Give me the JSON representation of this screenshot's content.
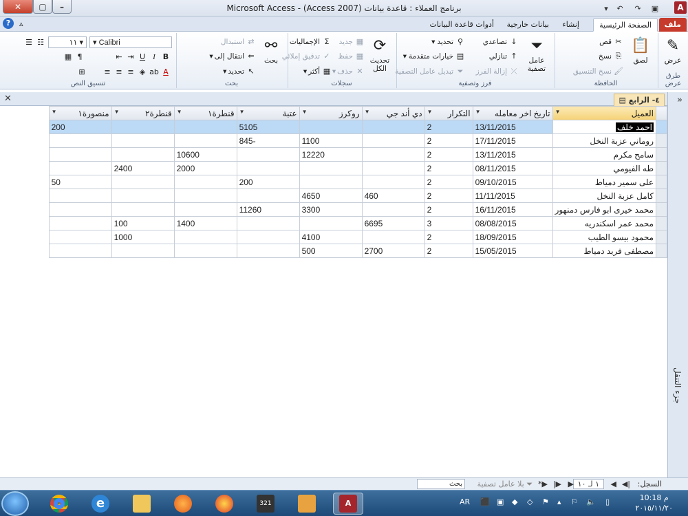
{
  "window": {
    "title": "برنامج العملاء : قاعدة بيانات (Access 2007) - Microsoft Access",
    "app_logo": "A"
  },
  "tabs": [
    {
      "label": "ملف"
    },
    {
      "label": "الصفحة الرئيسية"
    },
    {
      "label": "إنشاء"
    },
    {
      "label": "بيانات خارجية"
    },
    {
      "label": "أدوات قاعدة البيانات"
    }
  ],
  "ribbon": {
    "views": {
      "label": "طرق عرض",
      "view_btn": "عرض"
    },
    "clipboard": {
      "label": "الحافظة",
      "paste": "لصق",
      "cut": "قص",
      "copy": "نسخ",
      "format_painter": "نسخ التنسيق"
    },
    "sort_filter": {
      "label": "فرز وتصفية",
      "filter": "عامل تصفية",
      "ascending": "تصاعدي",
      "descending": "تنازلي",
      "remove_sort": "إزالة الفرز",
      "selection": "تحديد",
      "advanced": "خيارات متقدمة",
      "toggle_filter": "تبديل عامل التصفية"
    },
    "records": {
      "label": "سجلات",
      "refresh": "تحديث الكل",
      "new": "جديد",
      "save": "حفظ",
      "delete": "حذف",
      "totals": "الإجماليات",
      "spelling": "تدقيق إملائي",
      "more": "أكثر"
    },
    "find": {
      "label": "بحث",
      "find": "بحث",
      "replace": "استبدال",
      "goto": "انتقال إلى",
      "select": "تحديد"
    },
    "text_formatting": {
      "label": "تنسيق النص",
      "font": "Calibri",
      "size": "١١"
    }
  },
  "document": {
    "tab_title": "٤- الرابع",
    "nav_pane_label": "جزء التنقل"
  },
  "table": {
    "columns": [
      "العميل",
      "تاريخ اخر معامله",
      "التكرار",
      "دي أند جي",
      "روكرز",
      "عتبة",
      "قنطرة١",
      "قنطرة٢",
      "منصورة١"
    ],
    "rows": [
      [
        "احمد خلف",
        "13/11/2015",
        "2",
        "",
        "",
        "5105",
        "",
        "",
        "200"
      ],
      [
        "روماني عزبة النخل",
        "17/11/2015",
        "2",
        "",
        "1100",
        "-845",
        "",
        "",
        ""
      ],
      [
        "سامح مكرم",
        "13/11/2015",
        "2",
        "",
        "12220",
        "",
        "10600",
        "",
        ""
      ],
      [
        "طه الفيومي",
        "08/11/2015",
        "2",
        "",
        "",
        "",
        "2000",
        "2400",
        ""
      ],
      [
        "على سمير دمياط",
        "09/10/2015",
        "2",
        "",
        "",
        "200",
        "",
        "",
        "50"
      ],
      [
        "كامل عزبة النخل",
        "11/11/2015",
        "2",
        "460",
        "4650",
        "",
        "",
        "",
        ""
      ],
      [
        "محمد خيرى ابو فارس دمنهور",
        "16/11/2015",
        "2",
        "",
        "3300",
        "11260",
        "",
        "",
        ""
      ],
      [
        "محمد عمر اسكندريه",
        "08/08/2015",
        "3",
        "6695",
        "",
        "",
        "1400",
        "100",
        ""
      ],
      [
        "محمود بيسو الطيب",
        "18/09/2015",
        "2",
        "",
        "4100",
        "",
        "",
        "1000",
        ""
      ],
      [
        "مصطفى فريد دمياط",
        "15/05/2015",
        "2",
        "2700",
        "500",
        "",
        "",
        "",
        ""
      ]
    ]
  },
  "record_bar": {
    "label": "السجل:",
    "position": "١ لـ ١٠",
    "filter": "بلا عامل تصفية",
    "search": "بحث"
  },
  "taskbar": {
    "lang": "AR",
    "time": "10:18 م",
    "date": "٢٠١٥/١١/٢٠"
  },
  "colors": {
    "file_tab": "#c63b2b",
    "active_header": "#f5d276",
    "current_row": "#bcd9f5"
  }
}
